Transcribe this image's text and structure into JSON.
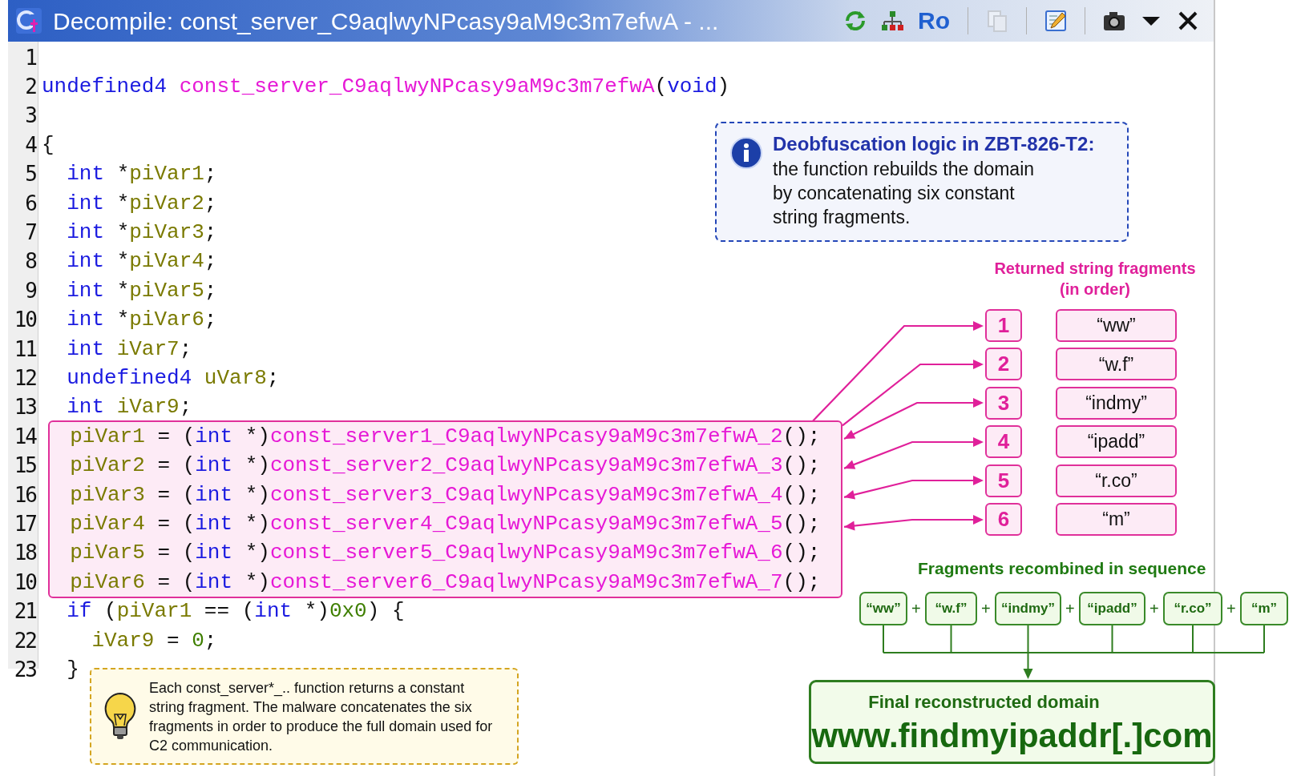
{
  "window": {
    "title": "Decompile: const_server_C9aqlwyNPcasy9aM9c3m7efwA - ...",
    "toolbar": [
      {
        "kind": "refresh",
        "disabled": false
      },
      {
        "kind": "graph",
        "disabled": false
      },
      {
        "kind": "text",
        "label": "Ro",
        "disabled": false
      },
      {
        "kind": "separator"
      },
      {
        "kind": "copy",
        "disabled": true
      },
      {
        "kind": "separator"
      },
      {
        "kind": "edit",
        "disabled": false
      },
      {
        "kind": "separator"
      },
      {
        "kind": "camera",
        "disabled": false
      },
      {
        "kind": "dropdown",
        "disabled": false
      },
      {
        "kind": "close",
        "disabled": false
      }
    ]
  },
  "code": {
    "lines": [
      {
        "number": "1",
        "highlighted": false
      },
      {
        "number": "2",
        "highlighted": false,
        "tokens": [
          {
            "kind": "keyword",
            "text": "undefined4 "
          },
          {
            "kind": "function",
            "text": "const_server_C9aqlwyNPcasy9aM9c3m7efwA"
          },
          {
            "kind": "plain",
            "text": "("
          },
          {
            "kind": "keyword",
            "text": "void"
          },
          {
            "kind": "plain",
            "text": ")"
          }
        ]
      },
      {
        "number": "3",
        "highlighted": false
      },
      {
        "number": "4",
        "highlighted": false,
        "tokens": [
          {
            "kind": "plain",
            "text": "{"
          }
        ]
      },
      {
        "number": "5",
        "highlighted": false,
        "tokens": [
          {
            "kind": "keyword",
            "text": "  int "
          },
          {
            "kind": "plain",
            "text": "*"
          },
          {
            "kind": "variable",
            "text": "piVar1"
          },
          {
            "kind": "plain",
            "text": ";"
          }
        ]
      },
      {
        "number": "6",
        "highlighted": false,
        "tokens": [
          {
            "kind": "keyword",
            "text": "  int "
          },
          {
            "kind": "plain",
            "text": "*"
          },
          {
            "kind": "variable",
            "text": "piVar2"
          },
          {
            "kind": "plain",
            "text": ";"
          }
        ]
      },
      {
        "number": "7",
        "highlighted": false,
        "tokens": [
          {
            "kind": "keyword",
            "text": "  int "
          },
          {
            "kind": "plain",
            "text": "*"
          },
          {
            "kind": "variable",
            "text": "piVar3"
          },
          {
            "kind": "plain",
            "text": ";"
          }
        ]
      },
      {
        "number": "8",
        "highlighted": false,
        "tokens": [
          {
            "kind": "keyword",
            "text": "  int "
          },
          {
            "kind": "plain",
            "text": "*"
          },
          {
            "kind": "variable",
            "text": "piVar4"
          },
          {
            "kind": "plain",
            "text": ";"
          }
        ]
      },
      {
        "number": "9",
        "highlighted": false,
        "tokens": [
          {
            "kind": "keyword",
            "text": "  int "
          },
          {
            "kind": "plain",
            "text": "*"
          },
          {
            "kind": "variable",
            "text": "piVar5"
          },
          {
            "kind": "plain",
            "text": ";"
          }
        ]
      },
      {
        "number": "10",
        "highlighted": false,
        "tokens": [
          {
            "kind": "keyword",
            "text": "  int "
          },
          {
            "kind": "plain",
            "text": "*"
          },
          {
            "kind": "variable",
            "text": "piVar6"
          },
          {
            "kind": "plain",
            "text": ";"
          }
        ]
      },
      {
        "number": "11",
        "highlighted": false,
        "tokens": [
          {
            "kind": "keyword",
            "text": "  int "
          },
          {
            "kind": "variable",
            "text": "iVar7"
          },
          {
            "kind": "plain",
            "text": ";"
          }
        ]
      },
      {
        "number": "12",
        "highlighted": false,
        "tokens": [
          {
            "kind": "keyword",
            "text": "  undefined4 "
          },
          {
            "kind": "variable",
            "text": "uVar8"
          },
          {
            "kind": "plain",
            "text": ";"
          }
        ]
      },
      {
        "number": "13",
        "highlighted": false,
        "tokens": [
          {
            "kind": "keyword",
            "text": "  int "
          },
          {
            "kind": "variable",
            "text": "iVar9"
          },
          {
            "kind": "plain",
            "text": ";"
          }
        ]
      },
      {
        "number": "14",
        "highlighted": true,
        "tokens": [
          {
            "kind": "variable",
            "text": "  piVar1"
          },
          {
            "kind": "plain",
            "text": " = ("
          },
          {
            "kind": "keyword",
            "text": "int"
          },
          {
            "kind": "plain",
            "text": " *)"
          },
          {
            "kind": "function",
            "text": "const_server1_C9aqlwyNPcasy9aM9c3m7efwA_2"
          },
          {
            "kind": "plain",
            "text": "();"
          }
        ]
      },
      {
        "number": "15",
        "highlighted": true,
        "tokens": [
          {
            "kind": "variable",
            "text": "  piVar2"
          },
          {
            "kind": "plain",
            "text": " = ("
          },
          {
            "kind": "keyword",
            "text": "int"
          },
          {
            "kind": "plain",
            "text": " *)"
          },
          {
            "kind": "function",
            "text": "const_server2_C9aqlwyNPcasy9aM9c3m7efwA_3"
          },
          {
            "kind": "plain",
            "text": "();"
          }
        ]
      },
      {
        "number": "16",
        "highlighted": true,
        "tokens": [
          {
            "kind": "variable",
            "text": "  piVar3"
          },
          {
            "kind": "plain",
            "text": " = ("
          },
          {
            "kind": "keyword",
            "text": "int"
          },
          {
            "kind": "plain",
            "text": " *)"
          },
          {
            "kind": "function",
            "text": "const_server3_C9aqlwyNPcasy9aM9c3m7efwA_4"
          },
          {
            "kind": "plain",
            "text": "();"
          }
        ]
      },
      {
        "number": "17",
        "highlighted": true,
        "tokens": [
          {
            "kind": "variable",
            "text": "  piVar4"
          },
          {
            "kind": "plain",
            "text": " = ("
          },
          {
            "kind": "keyword",
            "text": "int"
          },
          {
            "kind": "plain",
            "text": " *)"
          },
          {
            "kind": "function",
            "text": "const_server4_C9aqlwyNPcasy9aM9c3m7efwA_5"
          },
          {
            "kind": "plain",
            "text": "();"
          }
        ]
      },
      {
        "number": "18",
        "highlighted": true,
        "tokens": [
          {
            "kind": "variable",
            "text": "  piVar5"
          },
          {
            "kind": "plain",
            "text": " = ("
          },
          {
            "kind": "keyword",
            "text": "int"
          },
          {
            "kind": "plain",
            "text": " *)"
          },
          {
            "kind": "function",
            "text": "const_server5_C9aqlwyNPcasy9aM9c3m7efwA_6"
          },
          {
            "kind": "plain",
            "text": "();"
          }
        ]
      },
      {
        "number": "10",
        "highlighted": true,
        "tokens": [
          {
            "kind": "variable",
            "text": "  piVar6"
          },
          {
            "kind": "plain",
            "text": " = ("
          },
          {
            "kind": "keyword",
            "text": "int"
          },
          {
            "kind": "plain",
            "text": " *)"
          },
          {
            "kind": "function",
            "text": "const_server6_C9aqlwyNPcasy9aM9c3m7efwA_7"
          },
          {
            "kind": "plain",
            "text": "();"
          }
        ]
      },
      {
        "number": "21",
        "highlighted": false,
        "tokens": [
          {
            "kind": "keyword",
            "text": "  if"
          },
          {
            "kind": "plain",
            "text": " ("
          },
          {
            "kind": "variable",
            "text": "piVar1"
          },
          {
            "kind": "plain",
            "text": " == ("
          },
          {
            "kind": "keyword",
            "text": "int"
          },
          {
            "kind": "plain",
            "text": " *)"
          },
          {
            "kind": "constant",
            "text": "0x0"
          },
          {
            "kind": "plain",
            "text": ") {"
          }
        ]
      },
      {
        "number": "22",
        "highlighted": false,
        "tokens": [
          {
            "kind": "variable",
            "text": "    iVar9"
          },
          {
            "kind": "plain",
            "text": " = "
          },
          {
            "kind": "constant",
            "text": "0"
          },
          {
            "kind": "plain",
            "text": ";"
          }
        ]
      },
      {
        "number": "23",
        "highlighted": false,
        "tokens": [
          {
            "kind": "plain",
            "text": "  }"
          }
        ]
      }
    ]
  },
  "info_callout": {
    "title": "Deobfuscation logic in ZBT-826-T2:",
    "body": "the function rebuilds the domain by concatenating six constant string fragments."
  },
  "returned_fragments": {
    "heading": "Returned string fragments (in order)",
    "items": [
      {
        "number": "1",
        "text": "“ww”"
      },
      {
        "number": "2",
        "text": "“w.f”"
      },
      {
        "number": "3",
        "text": "“indmy”"
      },
      {
        "number": "4",
        "text": "“ipadd”"
      },
      {
        "number": "5",
        "text": "“r.co”"
      },
      {
        "number": "6",
        "text": "“m”"
      }
    ]
  },
  "recombined": {
    "heading": "Fragments recombined in sequence",
    "parts": [
      {
        "kind": "fragment",
        "text": "“ww”"
      },
      {
        "kind": "operator",
        "text": "+"
      },
      {
        "kind": "fragment",
        "text": "“w.f”"
      },
      {
        "kind": "operator",
        "text": "+"
      },
      {
        "kind": "fragment",
        "text": "“indmy”"
      },
      {
        "kind": "operator",
        "text": "+"
      },
      {
        "kind": "fragment",
        "text": "“ipadd”"
      },
      {
        "kind": "operator",
        "text": "+"
      },
      {
        "kind": "fragment",
        "text": "“r.co”"
      },
      {
        "kind": "operator",
        "text": "+"
      },
      {
        "kind": "fragment",
        "text": "“m”"
      }
    ]
  },
  "final_domain": {
    "label": "Final reconstructed domain",
    "domain": "www.findmyipaddr[.]com"
  },
  "note": {
    "text": "Each const_server*_.. function returns a constant string fragment. The malware concatenates the six fragments in order to produce the full domain used for C2 communication."
  }
}
